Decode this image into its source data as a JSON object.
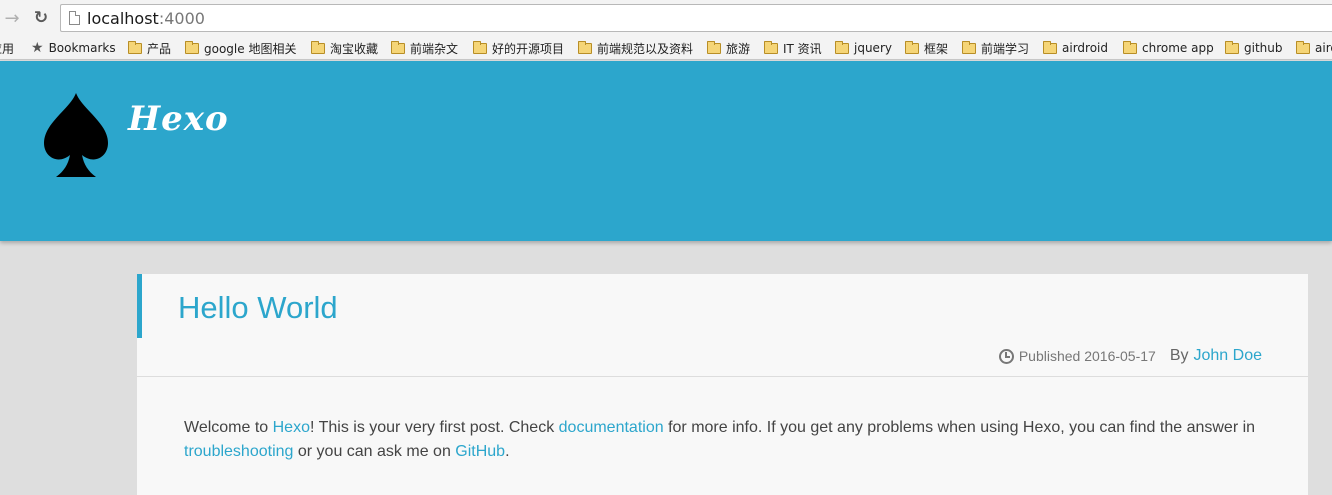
{
  "browser": {
    "url_host": "localhost",
    "url_port": ":4000"
  },
  "bookmarks": [
    {
      "label": "应用",
      "icon": "apps-icon"
    },
    {
      "label": "Bookmarks",
      "icon": "star-icon"
    },
    {
      "label": "产品",
      "icon": "folder-icon"
    },
    {
      "label": "google 地图相关",
      "icon": "folder-icon"
    },
    {
      "label": "淘宝收藏",
      "icon": "folder-icon"
    },
    {
      "label": "前端杂文",
      "icon": "folder-icon"
    },
    {
      "label": "好的开源项目",
      "icon": "folder-icon"
    },
    {
      "label": "前端规范以及资料",
      "icon": "folder-icon"
    },
    {
      "label": "旅游",
      "icon": "folder-icon"
    },
    {
      "label": "IT 资讯",
      "icon": "folder-icon"
    },
    {
      "label": "jquery",
      "icon": "folder-icon"
    },
    {
      "label": "框架",
      "icon": "folder-icon"
    },
    {
      "label": "前端学习",
      "icon": "folder-icon"
    },
    {
      "label": "airdroid",
      "icon": "folder-icon"
    },
    {
      "label": "chrome app",
      "icon": "folder-icon"
    },
    {
      "label": "github",
      "icon": "folder-icon"
    },
    {
      "label": "airdroid",
      "icon": "folder-icon"
    }
  ],
  "site": {
    "logo_text": "Hexo",
    "header_color": "#2ca6cc"
  },
  "post": {
    "title": "Hello World",
    "published_label": "Published 2016-05-17",
    "by_label": "By",
    "author": "John Doe",
    "body": {
      "t1": "Welcome to ",
      "link1": "Hexo",
      "t2": "! This is your very first post. Check ",
      "link2": "documentation",
      "t3": " for more info. If you get any problems when using Hexo, you can find the answer in ",
      "link3": "troubleshooting",
      "t4": " or you can ask me on ",
      "link4": "GitHub",
      "t5": "."
    }
  }
}
